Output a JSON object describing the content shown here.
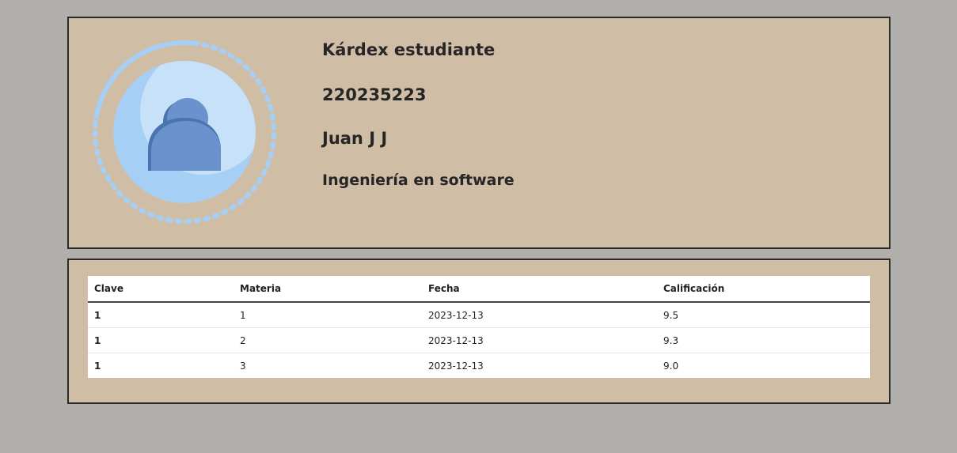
{
  "profile": {
    "title": "Kárdex estudiante",
    "student_id": "220235223",
    "name": "Juan J J",
    "career": "Ingeniería en software",
    "avatar_icon": "user-avatar-icon"
  },
  "grades": {
    "headers": [
      "Clave",
      "Materia",
      "Fecha",
      "Calificación"
    ],
    "rows": [
      [
        "1",
        "1",
        "2023-12-13",
        "9.5"
      ],
      [
        "1",
        "2",
        "2023-12-13",
        "9.3"
      ],
      [
        "1",
        "3",
        "2023-12-13",
        "9.0"
      ]
    ]
  },
  "colors": {
    "page_background": "#b1afab",
    "card_background": "#d0bda5",
    "card_border": "#2a2a2a",
    "avatar_light": "#c7e1f8",
    "avatar_mid": "#a6cff5",
    "avatar_person": "#5a86c2"
  }
}
